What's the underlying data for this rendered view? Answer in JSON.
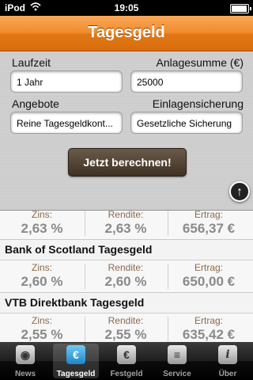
{
  "status": {
    "carrier": "iPod",
    "time": "19:05"
  },
  "header": {
    "title": "Tagesgeld"
  },
  "form": {
    "laufzeit_label": "Laufzeit",
    "laufzeit_value": "1 Jahr",
    "anlagesumme_label": "Anlagesumme (€)",
    "anlagesumme_value": "25000",
    "angebote_label": "Angebote",
    "angebote_value": "Reine Tagesgeldkont...",
    "einlagensicherung_label": "Einlagensicherung",
    "einlagensicherung_value": "Gesetzliche Sicherung",
    "calc_label": "Jetzt berechnen!"
  },
  "results": [
    {
      "bank": "",
      "zins_label": "Zins:",
      "zins": "2,63 %",
      "rendite_label": "Rendite:",
      "rendite": "2,63 %",
      "ertrag_label": "Ertrag:",
      "ertrag": "656,37 €"
    },
    {
      "bank": "Bank of Scotland Tagesgeld",
      "zins_label": "Zins:",
      "zins": "2,60 %",
      "rendite_label": "Rendite:",
      "rendite": "2,60 %",
      "ertrag_label": "Ertrag:",
      "ertrag": "650,00 €"
    },
    {
      "bank": "VTB Direktbank Tagesgeld",
      "zins_label": "Zins:",
      "zins": "2,55 %",
      "rendite_label": "Rendite:",
      "rendite": "2,55 %",
      "ertrag_label": "Ertrag:",
      "ertrag": "635,42 €"
    }
  ],
  "tabs": [
    {
      "label": "News",
      "icon": "rss-icon",
      "glyph": "◉"
    },
    {
      "label": "Tagesgeld",
      "icon": "euro-icon",
      "glyph": "€"
    },
    {
      "label": "Festgeld",
      "icon": "euro-safe-icon",
      "glyph": "€"
    },
    {
      "label": "Service",
      "icon": "document-icon",
      "glyph": "≡"
    },
    {
      "label": "Über",
      "icon": "info-icon",
      "glyph": "i"
    }
  ],
  "active_tab": "Tagesgeld",
  "colors": {
    "accent": "#f08a28",
    "button": "#4f4030"
  }
}
